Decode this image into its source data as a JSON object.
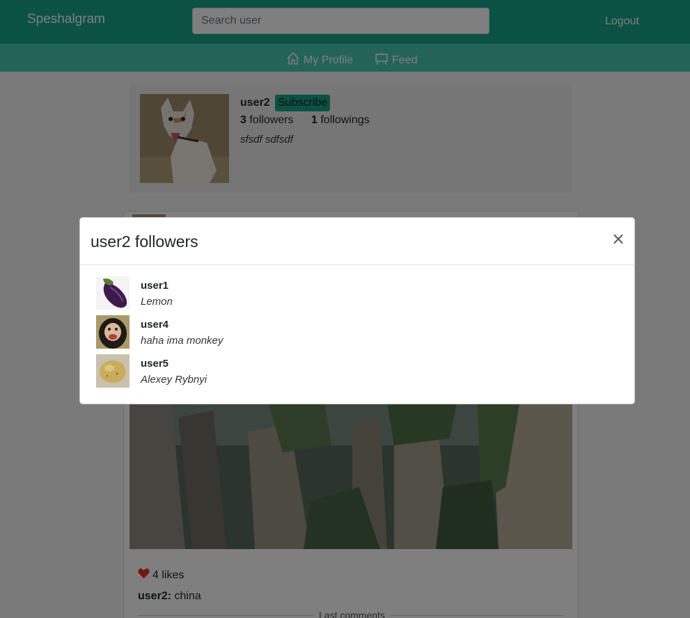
{
  "app": {
    "brand": "Speshalgram",
    "logout_label": "Logout",
    "search_placeholder": "Search user"
  },
  "nav": {
    "my_profile": "My Profile",
    "feed": "Feed"
  },
  "profile": {
    "username": "user2",
    "subscribe_label": "Subscribe",
    "followers_count": "3",
    "followers_label": "followers",
    "followings_count": "1",
    "followings_label": "followings",
    "bio": "sfsdf sdfsdf"
  },
  "post": {
    "likes": "4 likes",
    "author": "user2:",
    "caption": "china",
    "comments_label": "Last comments"
  },
  "modal": {
    "title": "user2 followers",
    "close_glyph": "×",
    "followers": [
      {
        "name": "user1",
        "bio": "Lemon",
        "avatar": "eggplant"
      },
      {
        "name": "user4",
        "bio": "haha ima monkey",
        "avatar": "monkey"
      },
      {
        "name": "user5",
        "bio": "Alexey Rybnyi",
        "avatar": "potato"
      }
    ]
  },
  "colors": {
    "primary": "#17a589",
    "secondary": "#48c9b0",
    "like": "#e0311b"
  }
}
